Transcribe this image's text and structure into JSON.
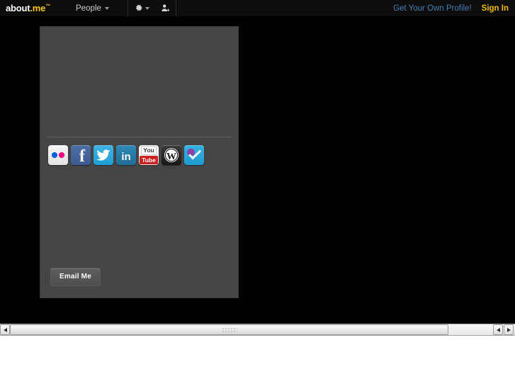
{
  "topbar": {
    "logo_main": "about",
    "logo_accent": ".me",
    "logo_tm": "™",
    "people_label": "People",
    "gear_icon": "gear-icon",
    "gear_caret_icon": "caret-down-icon",
    "add_person_icon": "add-person-icon",
    "get_profile_label": "Get Your Own Profile!",
    "sign_in_label": "Sign In",
    "colors": {
      "background": "#0d0d0d",
      "logo_accent": "#f5c518",
      "get_profile_link": "#3e7fb5",
      "sign_in_link": "#f0b90b",
      "people_text": "#c9c9c9"
    }
  },
  "profile_card": {
    "background": "#454545",
    "social_links": [
      {
        "name": "flickr",
        "label": "Flickr",
        "icon": "flickr-icon",
        "color": "#f0f0f0"
      },
      {
        "name": "facebook",
        "label": "Facebook",
        "icon": "facebook-icon",
        "color": "#3b5a92"
      },
      {
        "name": "twitter",
        "label": "Twitter",
        "icon": "twitter-icon",
        "color": "#1f9ed4"
      },
      {
        "name": "linkedin",
        "label": "LinkedIn",
        "icon": "linkedin-icon",
        "color": "#1f6f99"
      },
      {
        "name": "youtube",
        "label": "YouTube",
        "icon": "youtube-icon",
        "color": "#cc1f1f"
      },
      {
        "name": "wordpress",
        "label": "WordPress",
        "icon": "wordpress-icon",
        "color": "#171717"
      },
      {
        "name": "foursquare",
        "label": "Foursquare",
        "icon": "foursquare-icon",
        "color": "#1f9ad0"
      }
    ],
    "youtube_text_top": "You",
    "youtube_text_bottom": "Tube",
    "linkedin_text": "in",
    "facebook_text": "f",
    "email_button_label": "Email Me"
  },
  "scrollbar": {
    "orientation": "horizontal",
    "left_arrow_icon": "arrow-left-icon",
    "right_arrow_back_icon": "arrow-left-icon",
    "right_arrow_forward_icon": "arrow-right-icon",
    "grip_icon": "grip-dots-icon"
  }
}
